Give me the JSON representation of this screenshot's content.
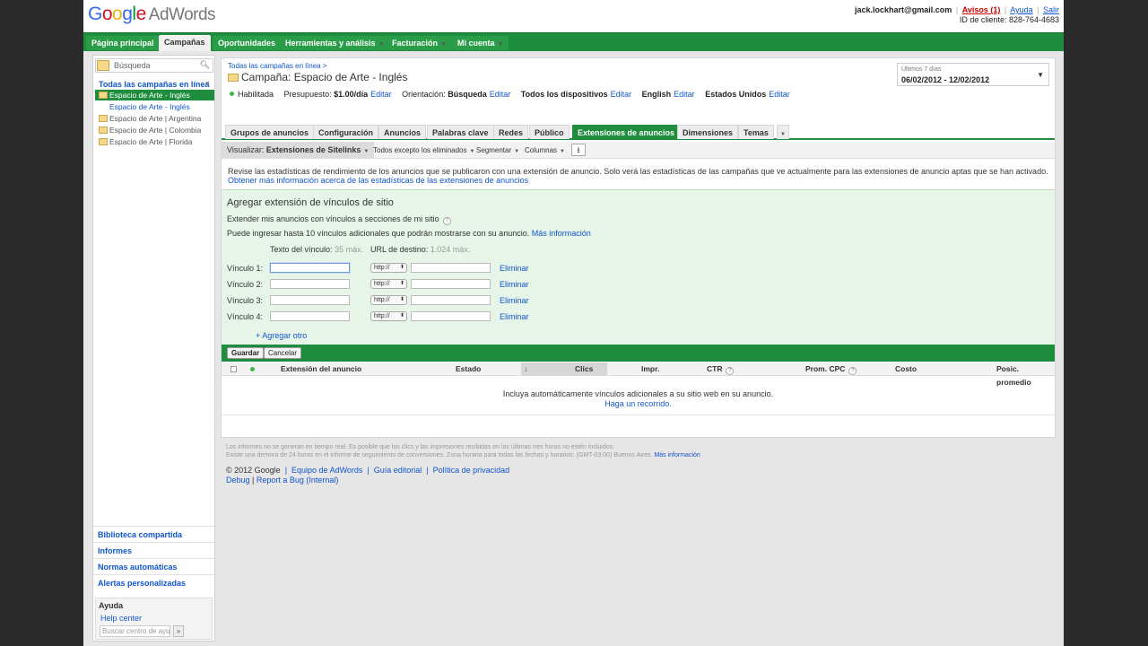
{
  "header": {
    "logo_google": [
      "G",
      "o",
      "o",
      "g",
      "l",
      "e"
    ],
    "logo_product": "AdWords",
    "user_email": "jack.lockhart@gmail.com",
    "alerts_link": "Avisos (1)",
    "help_link": "Ayuda",
    "logout_link": "Salir",
    "client_id": "ID de cliente: 828-764-4683"
  },
  "nav": [
    {
      "label": "Página principal"
    },
    {
      "label": "Campañas"
    },
    {
      "label": "Oportunidades"
    },
    {
      "label": "Herramientas y análisis"
    },
    {
      "label": "Facturación"
    },
    {
      "label": "Mi cuenta"
    }
  ],
  "sidebar": {
    "search_placeholder": "Búsqueda",
    "tree_title": "Todas las campañas en línea",
    "collapse_glyph": "«",
    "items": [
      {
        "label": "Espacio de Arte - Inglés"
      },
      {
        "label": "Espacio de Arte - Inglés"
      },
      {
        "label": "Espacio de Arte | Argentina"
      },
      {
        "label": "Espacio de Arte | Colombia"
      },
      {
        "label": "Espacio de Arte | Florida"
      }
    ],
    "links": [
      {
        "label": "Biblioteca compartida"
      },
      {
        "label": "Informes"
      },
      {
        "label": "Normas automáticas"
      },
      {
        "label": "Alertas personalizadas"
      }
    ],
    "help_title": "Ayuda",
    "help_center_link": "Help center",
    "help_search_placeholder": "Buscar centro de ayu",
    "help_search_btn": "»"
  },
  "campaign": {
    "breadcrumb": "Todas las campañas en línea >",
    "title_prefix": "Campaña:",
    "name": "Espacio de Arte - Inglés",
    "status": "Habilitada",
    "budget_label": "Presupuesto:",
    "budget_value": "$1.00/día",
    "orientation_label": "Orientación:",
    "orientation_value": "Búsqueda",
    "devices": "Todos los dispositivos",
    "language": "English",
    "location": "Estados Unidos",
    "edit_label": "Editar"
  },
  "date_range": {
    "label": "Últimos 7 días",
    "value": "06/02/2012 - 12/02/2012"
  },
  "tabs": [
    {
      "label": "Grupos de anuncios"
    },
    {
      "label": "Configuración"
    },
    {
      "label": "Anuncios"
    },
    {
      "label": "Palabras clave"
    },
    {
      "label": "Redes"
    },
    {
      "label": "Público"
    },
    {
      "label": "Extensiones de anuncios"
    },
    {
      "label": "Dimensiones"
    },
    {
      "label": "Temas"
    }
  ],
  "toolbar": {
    "visualize_label": "Visualizar:",
    "visualize_value": "Extensiones de Sitelinks",
    "filter": "Todos excepto los eliminados",
    "segment": "Segmentar",
    "columns": "Columnas"
  },
  "notice": {
    "text": "Revise las estadísticas de rendimiento de los anuncios que se publicaron con una extensión de anuncio. Solo verá las estadísticas de las campañas que ve actualmente para las extensiones de anuncio aptas que se han activado.",
    "link": "Obtener más información acerca de las estadísticas de las extensiones de anuncios"
  },
  "sitelinks_form": {
    "title": "Agregar extensión de vínculos de sitio",
    "subtitle": "Extender mis anuncios con vínculos a secciones de mi sitio",
    "help_glyph": "?",
    "info_text": "Puede ingresar hasta 10 vínculos adicionales que podrán mostrarse con su anuncio.",
    "info_link": "Más información",
    "col_link_text": "Texto del vínculo:",
    "col_link_max": "35 máx.",
    "col_url": "URL de destino:",
    "col_url_max": "1.024 máx.",
    "rows": [
      {
        "label": "Vínculo 1:",
        "protocol": "http://",
        "remove": "Eliminar"
      },
      {
        "label": "Vínculo 2:",
        "protocol": "http://",
        "remove": "Eliminar"
      },
      {
        "label": "Vínculo 3:",
        "protocol": "http://",
        "remove": "Eliminar"
      },
      {
        "label": "Vínculo 4:",
        "protocol": "http://",
        "remove": "Eliminar"
      }
    ],
    "add_other": "+ Agregar otro",
    "save": "Guardar",
    "cancel": "Cancelar"
  },
  "table": {
    "headers": [
      "Extensión del anuncio",
      "Estado",
      "Clics",
      "Impr.",
      "CTR",
      "Prom. CPC",
      "Costo",
      "Posic. promedio"
    ],
    "sort_glyph": "↓",
    "empty_text": "Incluya automáticamente vínculos adicionales a su sitio web en su anuncio.",
    "empty_link": "Haga un recorrido."
  },
  "footer": {
    "note_line1": "Los informes no se generan en tiempo real. Es posible que los clics y las impresiones recibidas en las últimas tres horas no estén incluidos.",
    "note_line2": "Existe una demora de 24 horas en el informe de seguimiento de conversiones. Zona horaria para todas las fechas y horarios: (GMT-03:00) Buenos Aires.",
    "note_link": "Más información",
    "copyright": "© 2012 Google",
    "links": [
      "Equipo de AdWords",
      "Guía editorial",
      "Política de privacidad"
    ],
    "debug": "Debug",
    "report_bug": "Report a Bug (Internal)"
  },
  "colors": {
    "brand_green": "#1e8e3e",
    "link_blue": "#1155cc",
    "panel_green": "#e6f5e7"
  }
}
